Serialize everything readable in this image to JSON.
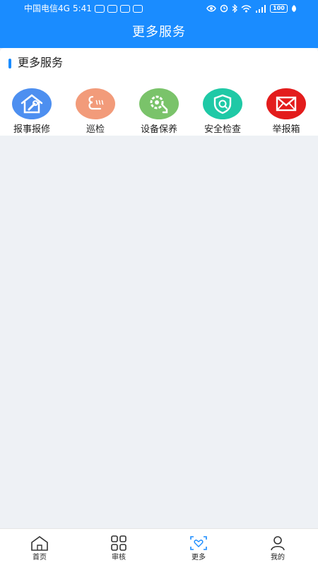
{
  "status_bar": {
    "carrier": "中国电信4G",
    "time": "5:41",
    "battery": "100"
  },
  "header": {
    "title": "更多服务"
  },
  "section": {
    "title": "更多服务"
  },
  "services": [
    {
      "label": "报事报修",
      "icon": "house-repair-icon",
      "color": "#4d8ff0"
    },
    {
      "label": "巡检",
      "icon": "patrol-icon",
      "color": "#f29b7a"
    },
    {
      "label": "设备保养",
      "icon": "equipment-maintenance-icon",
      "color": "#7ac36a"
    },
    {
      "label": "安全检查",
      "icon": "shield-check-icon",
      "color": "#1fc9a6"
    },
    {
      "label": "举报箱",
      "icon": "mail-icon",
      "color": "#e31c1c"
    }
  ],
  "bottom_nav": {
    "items": [
      {
        "label": "首页",
        "icon": "home-icon"
      },
      {
        "label": "审核",
        "icon": "grid-icon"
      },
      {
        "label": "更多",
        "icon": "heart-frame-icon",
        "active": true
      },
      {
        "label": "我的",
        "icon": "person-icon"
      }
    ]
  },
  "colors": {
    "primary": "#1a8cff",
    "background": "#eef1f5"
  }
}
